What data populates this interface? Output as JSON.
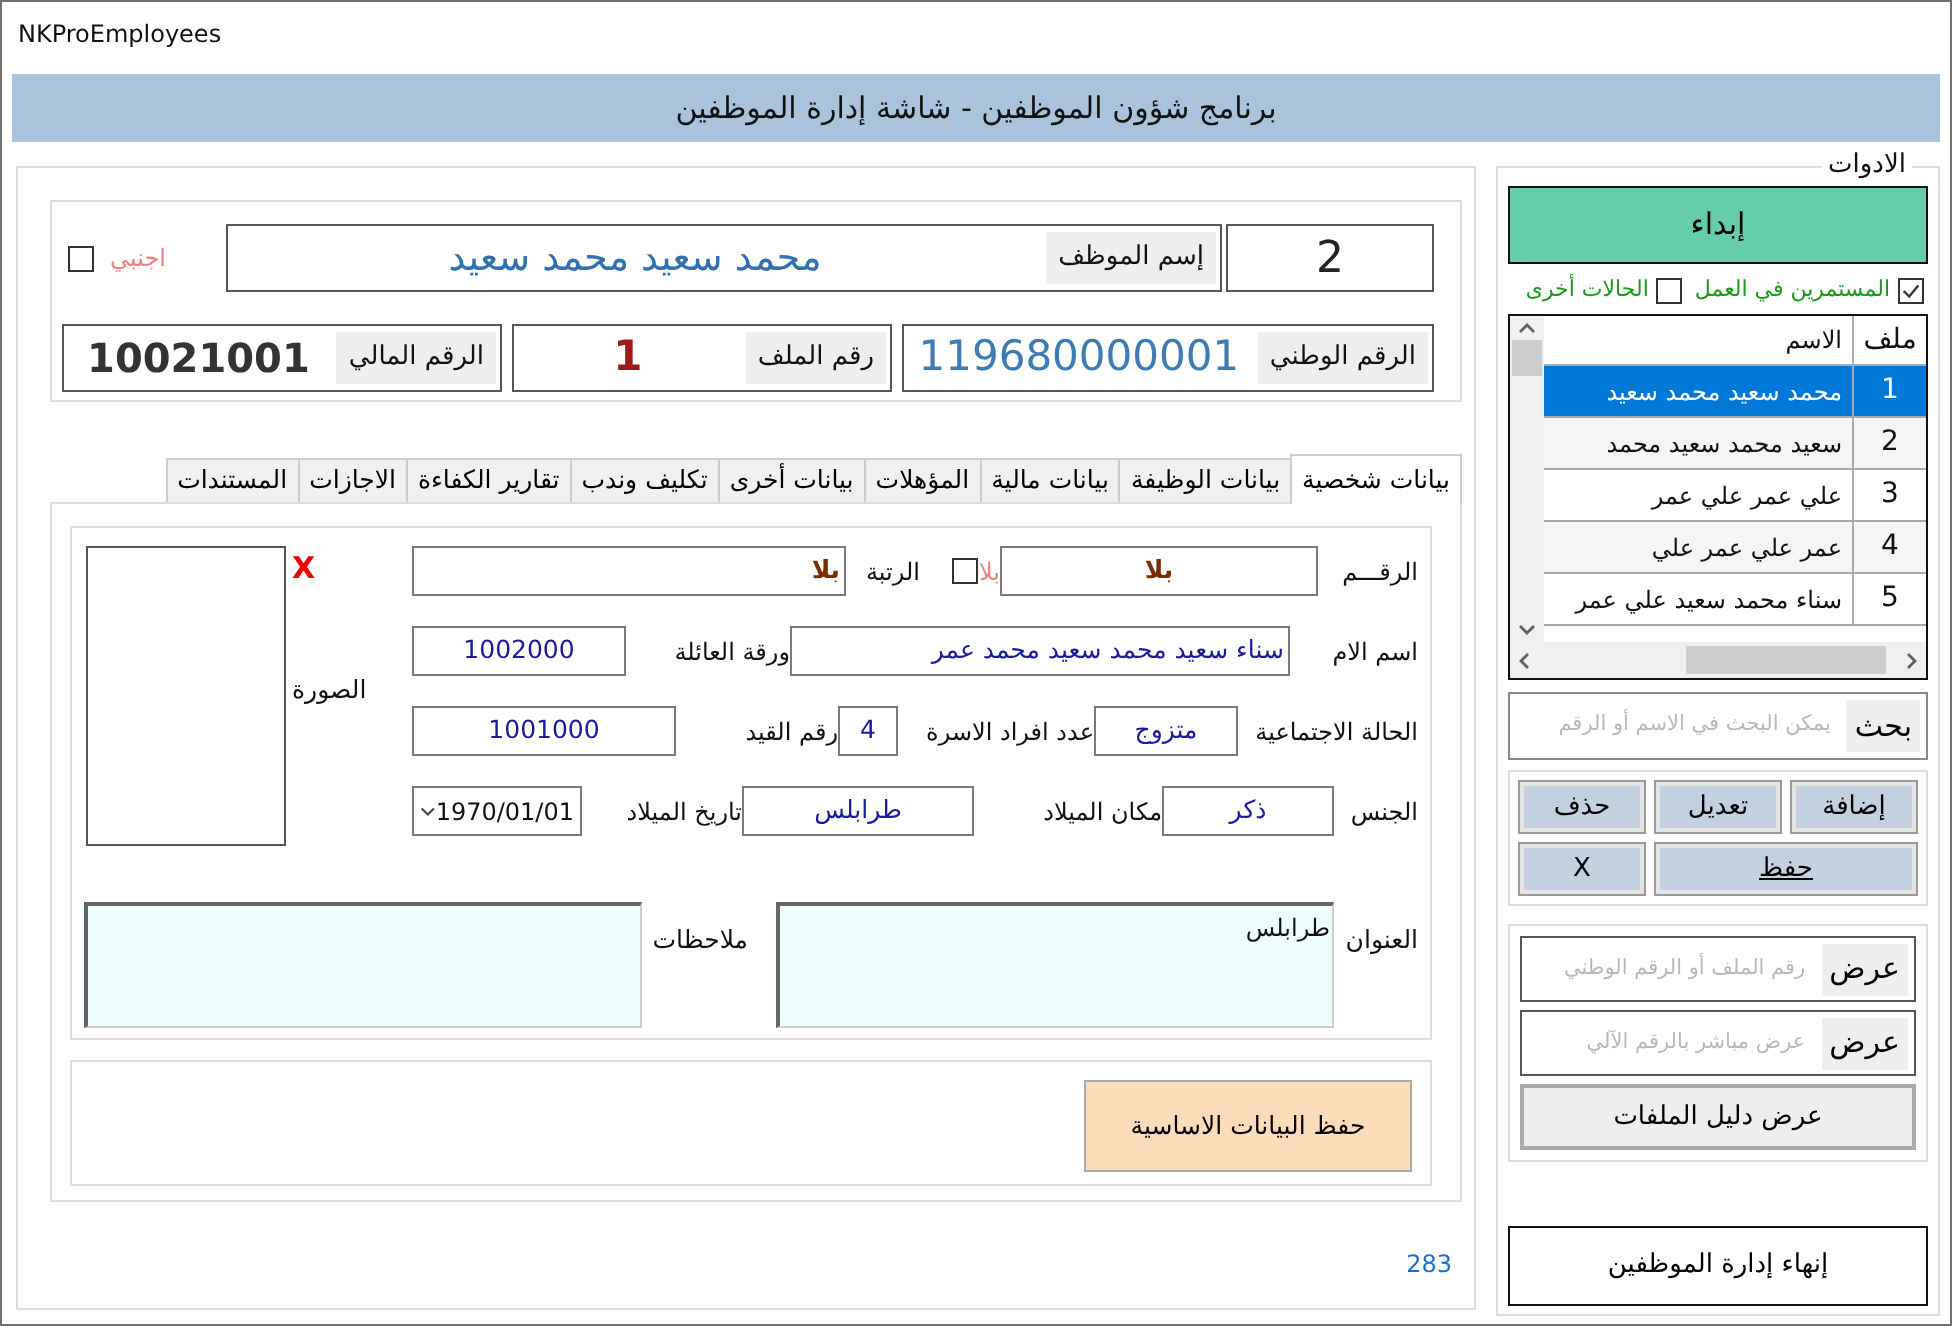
{
  "window": {
    "title": "NKProEmployees"
  },
  "header": {
    "title": "برنامج شؤون الموظفين - شاشة إدارة الموظفين"
  },
  "employee": {
    "serial": "2",
    "name_label": "إسم الموظف",
    "name": "محمد سعيد محمد سعيد",
    "foreign_label": "اجنبي",
    "foreign": false,
    "national_id_label": "الرقم الوطني",
    "national_id": "119680000001",
    "file_no_label": "رقم الملف",
    "file_no": "1",
    "financial_no_label": "الرقم المالي",
    "financial_no": "10021001"
  },
  "tabs": [
    {
      "label": "بيانات شخصية",
      "selected": true
    },
    {
      "label": "بيانات الوظيفة",
      "selected": false
    },
    {
      "label": "بيانات مالية",
      "selected": false
    },
    {
      "label": "المؤهلات",
      "selected": false
    },
    {
      "label": "بيانات أخرى",
      "selected": false
    },
    {
      "label": "تكليف وندب",
      "selected": false
    },
    {
      "label": "تقارير الكفاءة",
      "selected": false
    },
    {
      "label": "الاجازات",
      "selected": false
    },
    {
      "label": "المستندات",
      "selected": false
    }
  ],
  "personal": {
    "number_label": "الرقـــم",
    "number": "بلا",
    "none_label": "بلا",
    "none": false,
    "rank_label": "الرتبة",
    "rank": "بلا",
    "mother_label": "اسم الام",
    "mother": "سناء سعيد محمد سعيد محمد عمر",
    "family_sheet_label": "ورقة العائلة",
    "family_sheet": "1002000",
    "marital_label": "الحالة الاجتماعية",
    "marital": "متزوج",
    "family_size_label": "عدد افراد الاسرة",
    "family_size": "4",
    "registry_label": "رقم القيد",
    "registry": "1001000",
    "gender_label": "الجنس",
    "gender": "ذكر",
    "birth_place_label": "مكان الميلاد",
    "birth_place": "طرابلس",
    "birth_date_label": "تاريخ الميلاد",
    "birth_date": "1970/01/01",
    "photo_label": "الصورة",
    "photo_clear": "X",
    "address_label": "العنوان",
    "address": "طرابلس",
    "notes_label": "ملاحظات"
  },
  "save_button": "حفظ البيانات الاساسية",
  "record_count": "283",
  "tools": {
    "legend": "الادوات",
    "start_button": "إبداء",
    "filters": [
      {
        "label": "المستمرين في العمل",
        "checked": true
      },
      {
        "label": "الحالات أخرى",
        "checked": false
      }
    ],
    "grid": {
      "columns": [
        "ملف",
        "الاسم"
      ],
      "rows": [
        {
          "file": "1",
          "name": "محمد سعيد محمد سعيد",
          "selected": true
        },
        {
          "file": "2",
          "name": "سعيد محمد سعيد محمد",
          "selected": false
        },
        {
          "file": "3",
          "name": "علي عمر علي عمر",
          "selected": false
        },
        {
          "file": "4",
          "name": "عمر علي عمر علي",
          "selected": false
        },
        {
          "file": "5",
          "name": "سناء محمد سعيد علي عمر",
          "selected": false
        }
      ]
    },
    "search": {
      "placeholder": "يمكن البحث في الاسم أو الرقم",
      "button": "بحث"
    },
    "actions": [
      "إضافة",
      "تعديل",
      "حذف",
      "حفظ",
      "X"
    ],
    "lookups": [
      {
        "placeholder": "رقم الملف أو الرقم الوطني",
        "button": "عرض"
      },
      {
        "placeholder": "عرض مباشر بالرقم الآلي",
        "button": "عرض"
      }
    ],
    "directory_button": "عرض دليل الملفات",
    "exit_button": "إنهاء إدارة الموظفين"
  }
}
